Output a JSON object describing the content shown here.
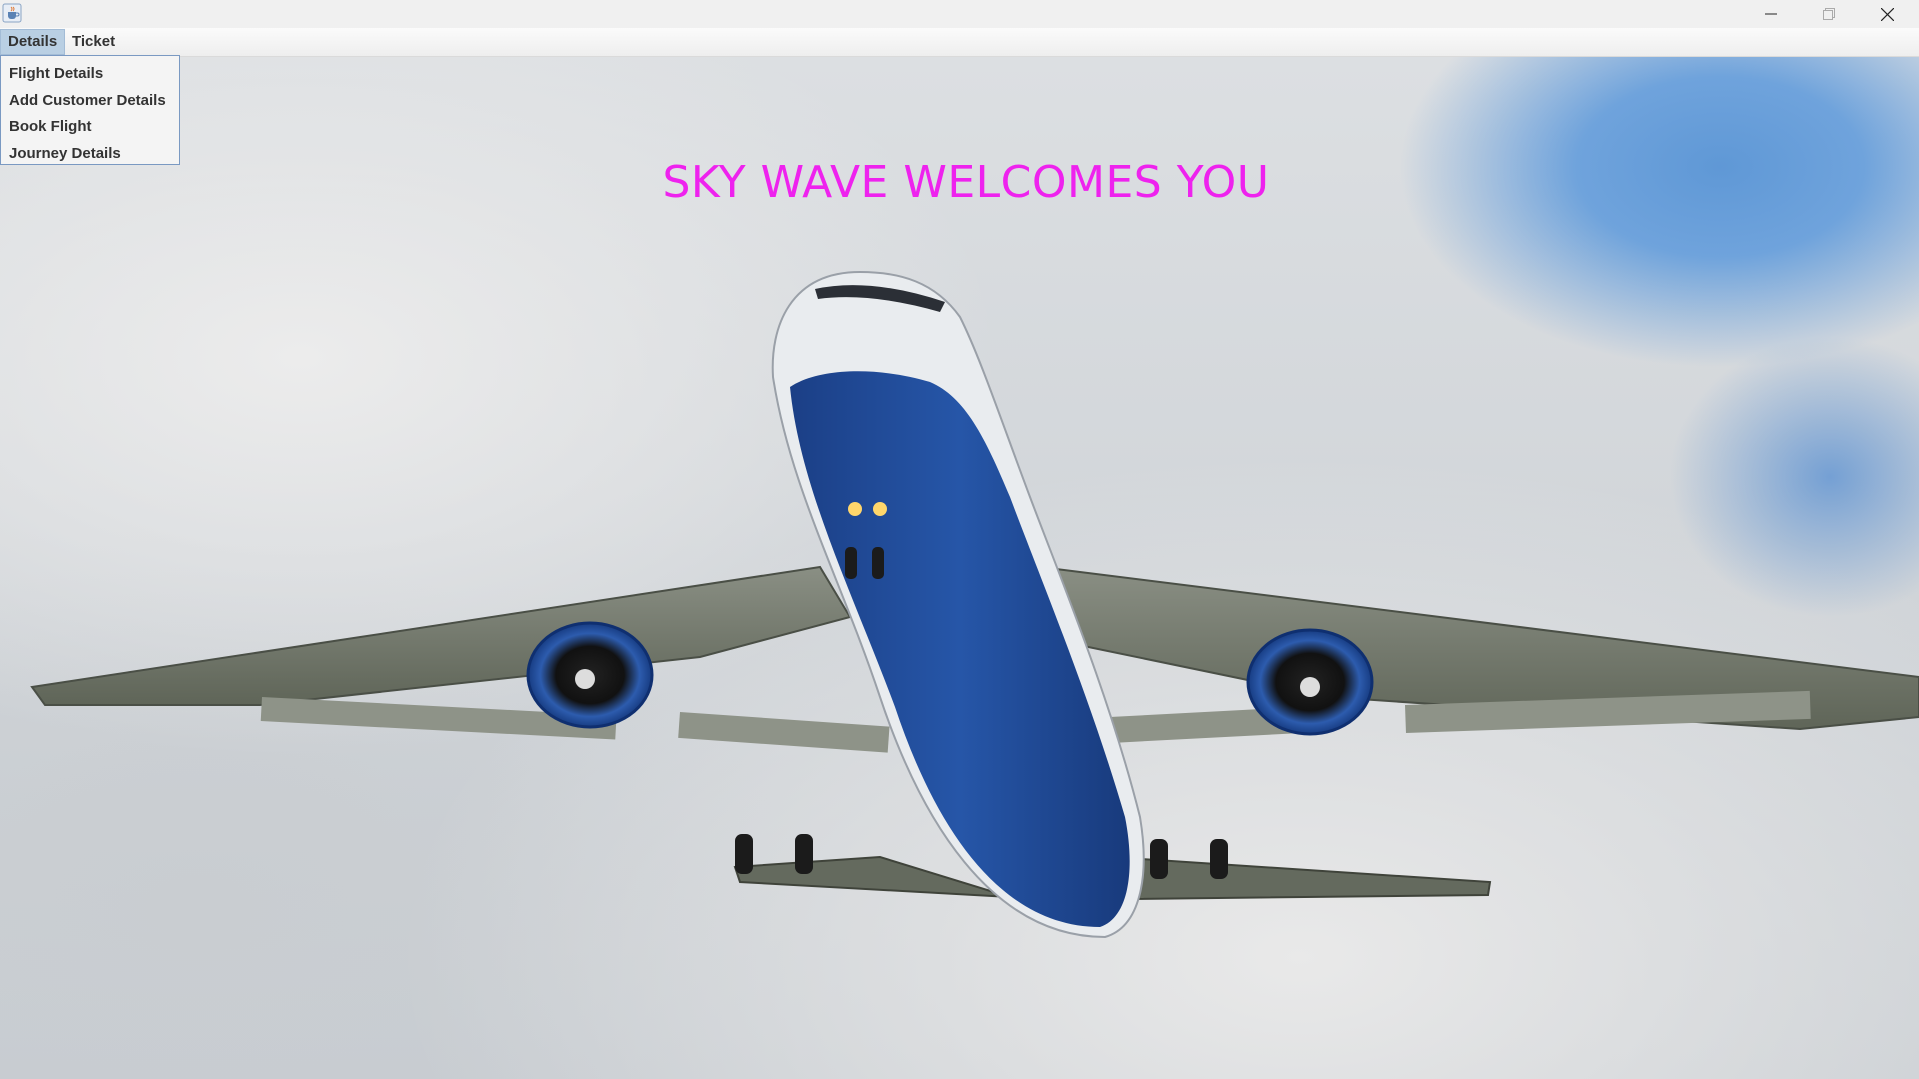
{
  "window": {
    "app_icon": "java-cup-icon",
    "controls": {
      "minimize": "minimize-icon",
      "maximize": "maximize-icon",
      "close": "close-icon"
    }
  },
  "menubar": {
    "menus": [
      {
        "label": "Details",
        "state": "open"
      },
      {
        "label": "Ticket"
      }
    ]
  },
  "details_menu": {
    "items": [
      "Flight Details",
      "Add Customer Details",
      "Book Flight",
      "Journey Details"
    ]
  },
  "main": {
    "heading": "SKY WAVE WELCOMES YOU",
    "heading_color": "#ee22ee",
    "background": "airplane-in-cloudy-sky-photo"
  }
}
